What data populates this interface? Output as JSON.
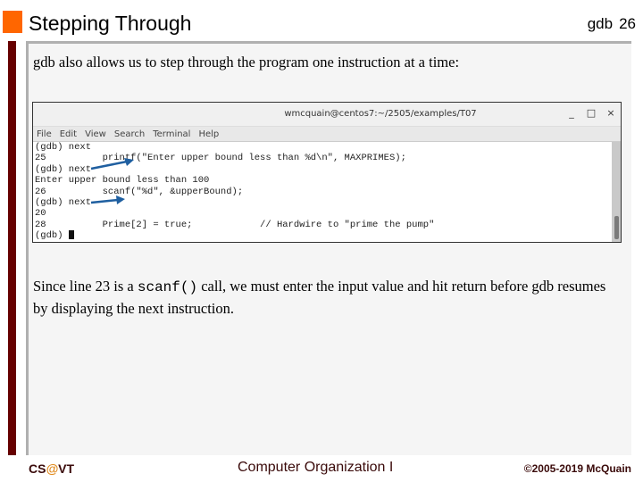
{
  "slide": {
    "title": "Stepping Through",
    "section": "gdb",
    "page_number": "26",
    "intro_text": "gdb also allows us to step through the program one instruction at a time:",
    "paragraph": {
      "before_code": "Since line 23 is a ",
      "code": "scanf()",
      "after_code": " call, we must enter the input value and hit return before gdb resumes by displaying the next instruction."
    }
  },
  "terminal": {
    "window_title": "wmcquain@centos7:~/2505/examples/T07",
    "window_buttons": {
      "minimize": "_",
      "maximize": "□",
      "close": "×"
    },
    "menu": [
      "File",
      "Edit",
      "View",
      "Search",
      "Terminal",
      "Help"
    ],
    "lines": [
      "(gdb) next",
      "25          printf(\"Enter upper bound less than %d\\n\", MAXPRIMES);",
      "(gdb) next",
      "Enter upper bound less than 100",
      "26          scanf(\"%d\", &upperBound);",
      "(gdb) next",
      "20",
      "28          Prime[2] = true;            // Hardwire to \"prime the pump\"",
      "(gdb) "
    ],
    "annotation_color": "#1f5fa0"
  },
  "footer": {
    "left_prefix": "CS",
    "left_at": "@",
    "left_suffix": "VT",
    "center": "Computer Organization I",
    "right": "©2005-2019 McQuain"
  },
  "colors": {
    "accent_orange": "#ff6600",
    "maroon": "#660000",
    "footer_text": "#3a0a0a"
  }
}
